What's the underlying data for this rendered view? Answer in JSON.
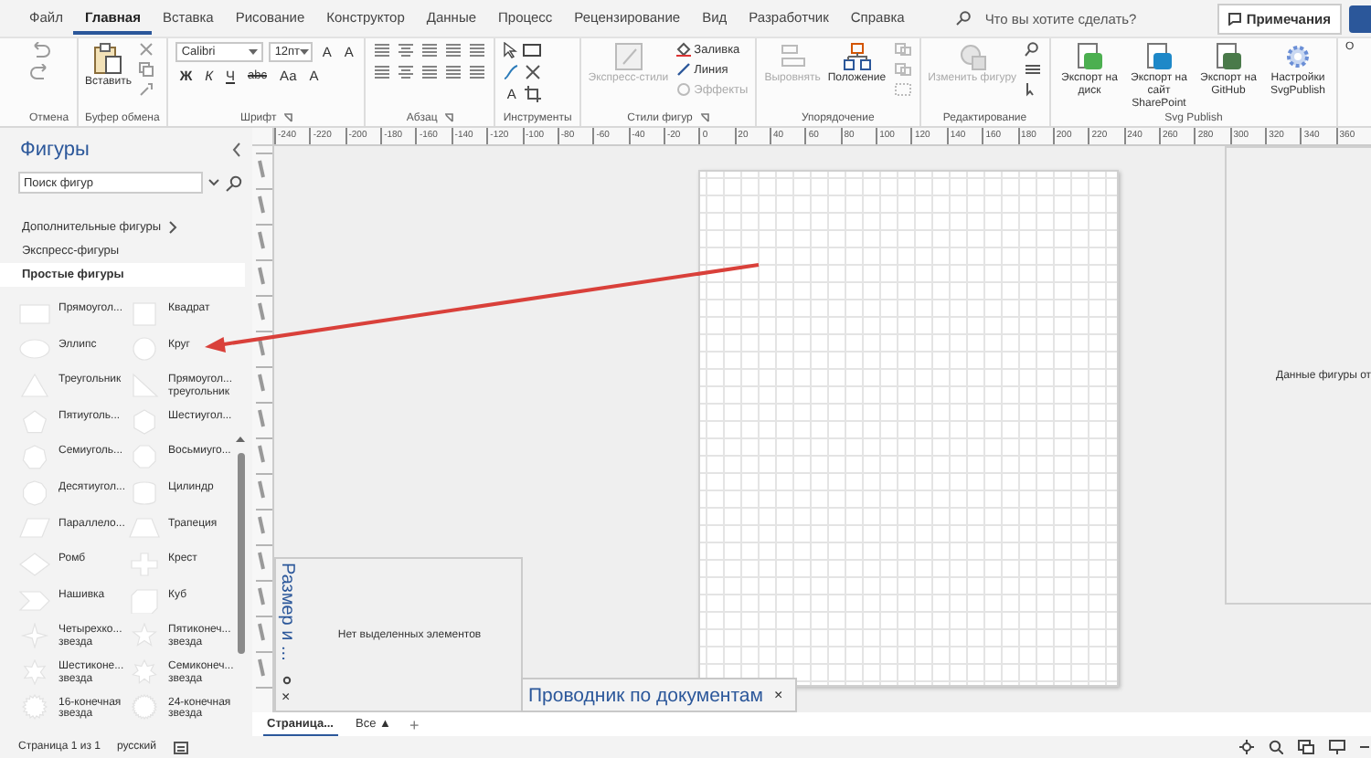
{
  "menu": {
    "tabs": [
      {
        "label": "Файл",
        "selected": false
      },
      {
        "label": "Главная",
        "selected": true
      },
      {
        "label": "Вставка",
        "selected": false
      },
      {
        "label": "Рисование",
        "selected": false
      },
      {
        "label": "Конструктор",
        "selected": false
      },
      {
        "label": "Данные",
        "selected": false
      },
      {
        "label": "Процесс",
        "selected": false
      },
      {
        "label": "Рецензирование",
        "selected": false
      },
      {
        "label": "Вид",
        "selected": false
      },
      {
        "label": "Разработчик",
        "selected": false
      },
      {
        "label": "Справка",
        "selected": false
      }
    ],
    "search": {
      "placeholder": "Что вы хотите сделать?"
    },
    "comments_button": {
      "label": "Примечания"
    }
  },
  "ribbon": {
    "groups": [
      {
        "kind": "undo",
        "label": "Отмена"
      },
      {
        "kind": "clipboard",
        "label": "Буфер обмена",
        "paste": "Вставить"
      },
      {
        "kind": "font",
        "label": "Шрифт",
        "font": "Calibri",
        "size": "12пт",
        "grow": "A",
        "shrink": "A",
        "styles": [
          "Ж",
          "К",
          "Ч",
          "abc",
          "Аа"
        ],
        "font_color_button": "А"
      },
      {
        "kind": "paragraph",
        "label": "Абзац"
      },
      {
        "kind": "tools",
        "label": "Инструменты",
        "text_tool": "A"
      },
      {
        "kind": "styles",
        "label": "Стили фигур",
        "items": [
          {
            "label": "Экспресс-стили",
            "disabled": true
          },
          {
            "label": "Заливка",
            "disabled": false
          },
          {
            "label": "Линия",
            "disabled": false
          },
          {
            "label": "Эффекты",
            "disabled": true
          }
        ]
      },
      {
        "kind": "arrange",
        "label": "Упорядочение",
        "items": [
          {
            "label": "Выровнять",
            "disabled": true
          },
          {
            "label": "Положение",
            "disabled": false
          }
        ]
      },
      {
        "kind": "editing",
        "label": "Редактирование",
        "items": [
          {
            "label": "Изменить фигуру",
            "disabled": true
          }
        ]
      },
      {
        "kind": "svg",
        "label": "Svg Publish",
        "items": [
          {
            "label": "Экспорт на диск"
          },
          {
            "label": "Экспорт на сайт SharePoint"
          },
          {
            "label": "Экспорт на GitHub"
          },
          {
            "label": "Настройки SvgPublish"
          }
        ]
      },
      {
        "kind": "partial",
        "button": "О"
      }
    ]
  },
  "ruler": {
    "labels": [
      "-240",
      "-220",
      "-200",
      "-180",
      "-160",
      "-140",
      "-120",
      "-100",
      "-80",
      "-60",
      "-40",
      "-20",
      "0",
      "20",
      "40",
      "60",
      "80",
      "100",
      "120",
      "140",
      "160",
      "180",
      "200",
      "220",
      "240",
      "260",
      "280",
      "300",
      "320",
      "340",
      "360"
    ]
  },
  "shapes_panel": {
    "title": "Фигуры",
    "search": {
      "placeholder": "Поиск фигур"
    },
    "stencils": [
      {
        "label": "Дополнительные фигуры",
        "kind": "more",
        "selected": false
      },
      {
        "label": "Экспресс-фигуры",
        "kind": "stencil",
        "selected": false
      },
      {
        "label": "Простые фигуры",
        "kind": "stencil",
        "selected": true
      }
    ],
    "shapes": [
      "Прямоугол...",
      "Квадрат",
      "Эллипс",
      "Круг",
      "Треугольник",
      "Прямоугол... треугольник",
      "Пятиуголь...",
      "Шестиугол...",
      "Семиуголь...",
      "Восьмиуго...",
      "Десятиугол...",
      "Цилиндр",
      "Параллело...",
      "Трапеция",
      "Ромб",
      "Крест",
      "Нашивка",
      "Куб",
      "Четырехко... звезда",
      "Пятиконеч... звезда",
      "Шестиконе... звезда",
      "Семиконеч... звезда",
      "16-конечная звезда",
      "24-конечная звезда"
    ]
  },
  "canvas": {
    "shape_data_panel": {
      "text": "Данные фигуры от"
    },
    "size_panel": {
      "title": "Размер и ...",
      "message": "Нет выделенных элементов",
      "close": "×"
    },
    "document_explorer": {
      "title": "Проводник по документам",
      "close": "×"
    }
  },
  "page_tabs": {
    "tabs": [
      {
        "label": "Страница...",
        "selected": true
      }
    ],
    "all_pages": "Все ▲",
    "add": "+"
  },
  "status_bar": {
    "page": "Страница 1 из 1",
    "language": "русский"
  }
}
